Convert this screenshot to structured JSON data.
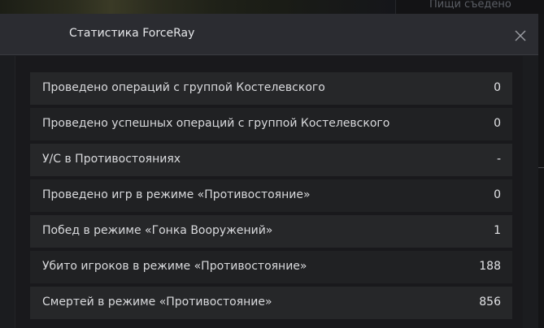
{
  "background": {
    "side_text": "Пищи съедено"
  },
  "dialog": {
    "title": "Статистика ForceRay",
    "close_icon": "close-icon"
  },
  "stats": [
    {
      "label": "Проведено операций с группой Костелевского",
      "value": "0"
    },
    {
      "label": "Проведено успешных операций с группой Костелевского",
      "value": "0"
    },
    {
      "label": "У/С в Противостояниях",
      "value": "-"
    },
    {
      "label": "Проведено игр в режиме «Противостояние»",
      "value": "0"
    },
    {
      "label": "Побед в режиме «Гонка Вооружений»",
      "value": "1"
    },
    {
      "label": "Убито игроков в режиме «Противостояние»",
      "value": "188"
    },
    {
      "label": "Смертей в режиме «Противостояние»",
      "value": "856"
    }
  ],
  "colors": {
    "header_bg": "#2b2c31",
    "row_bg": "#262729",
    "row_alt_bg": "#202123",
    "text": "#d9dadd"
  }
}
